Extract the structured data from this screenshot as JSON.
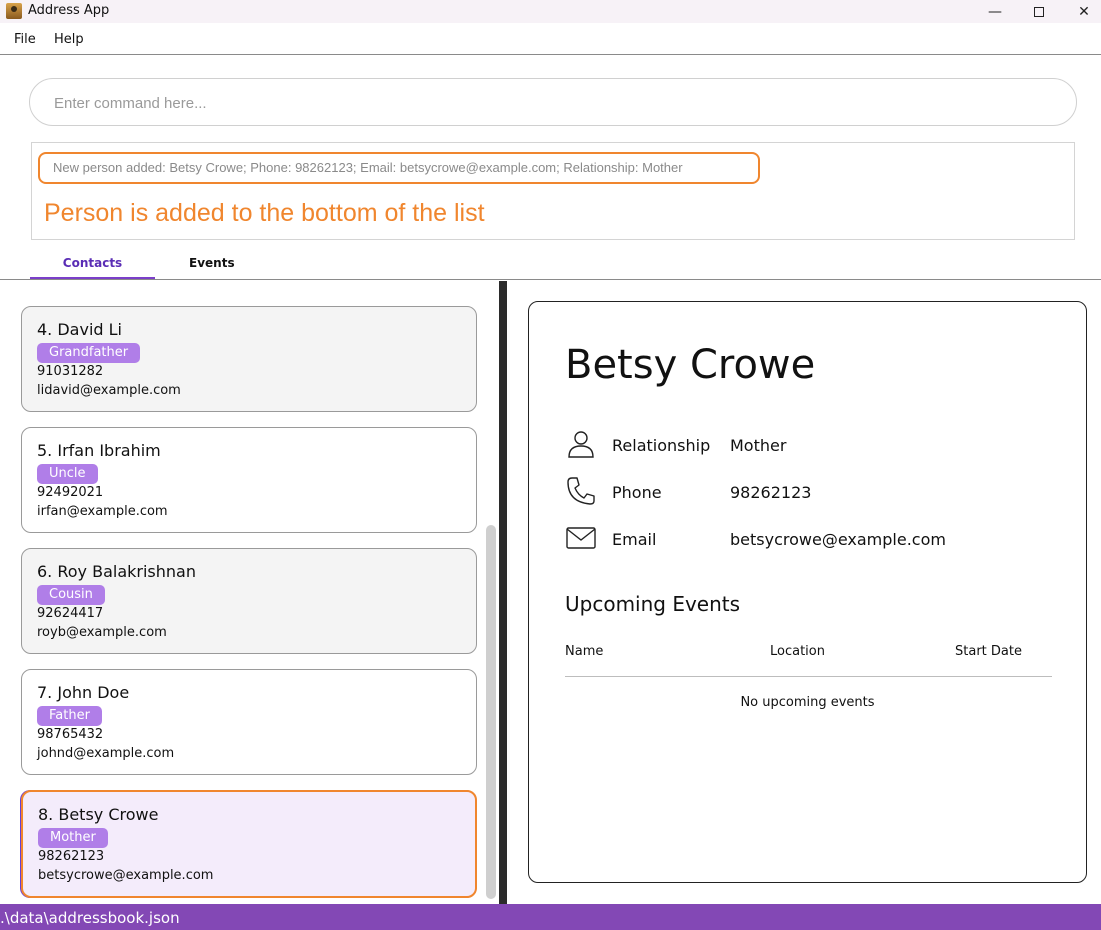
{
  "window": {
    "title": "Address App",
    "minimize": "—",
    "close": "✕"
  },
  "menu": {
    "file": "File",
    "help": "Help"
  },
  "command": {
    "placeholder": "Enter command here..."
  },
  "result": {
    "message": "New person added: Betsy Crowe; Phone: 98262123; Email: betsycrowe@example.com; Relationship: Mother",
    "note": "Person is added to the bottom of the list"
  },
  "tabs": {
    "contacts": "Contacts",
    "events": "Events"
  },
  "contacts": [
    {
      "name": "4. David Li",
      "tag": "Grandfather",
      "phone": "91031282",
      "email": "lidavid@example.com"
    },
    {
      "name": "5. Irfan Ibrahim",
      "tag": "Uncle",
      "phone": "92492021",
      "email": "irfan@example.com"
    },
    {
      "name": "6. Roy Balakrishnan",
      "tag": "Cousin",
      "phone": "92624417",
      "email": "royb@example.com"
    },
    {
      "name": "7. John Doe",
      "tag": "Father",
      "phone": "98765432",
      "email": "johnd@example.com"
    },
    {
      "name": "8. Betsy Crowe",
      "tag": "Mother",
      "phone": "98262123",
      "email": "betsycrowe@example.com"
    }
  ],
  "detail": {
    "name": "Betsy Crowe",
    "relationship_label": "Relationship",
    "relationship": "Mother",
    "phone_label": "Phone",
    "phone": "98262123",
    "email_label": "Email",
    "email": "betsycrowe@example.com",
    "events_heading": "Upcoming Events",
    "columns": [
      "Name",
      "Location",
      "Start Date"
    ],
    "empty_text": "No upcoming events"
  },
  "status": {
    "path": ".\\data\\addressbook.json"
  },
  "colors": {
    "accent": "#8348b5",
    "tag": "#b07ee8",
    "highlight": "#f0862e"
  }
}
